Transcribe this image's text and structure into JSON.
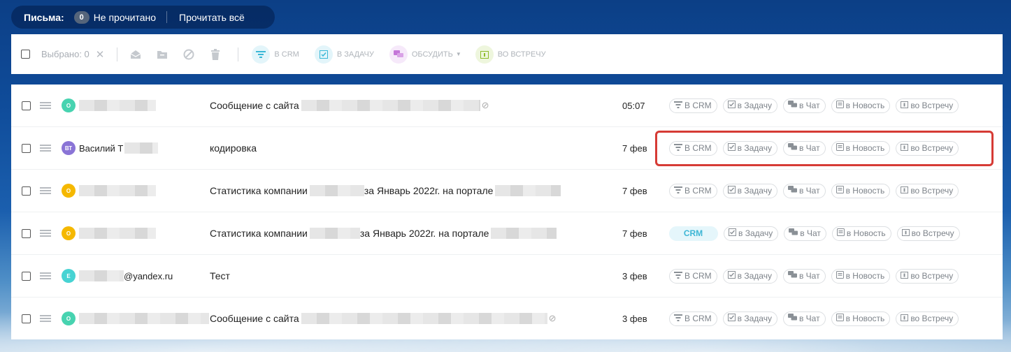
{
  "header": {
    "title": "Письма:",
    "unread_count": "0",
    "unread_label": "Не прочитано",
    "read_all": "Прочитать всё"
  },
  "toolbar": {
    "selected_label": "Выбрано: 0",
    "actions": [
      {
        "label": "в CRM",
        "color": "#39b7d6"
      },
      {
        "label": "в задачу",
        "color": "#39b7d6"
      },
      {
        "label": "обсудить",
        "color": "#c476d8"
      },
      {
        "label": "во встречу",
        "color": "#8dbb2a"
      }
    ]
  },
  "row_actions": {
    "crm": "В CRM",
    "task": "в Задачу",
    "chat": "в Чат",
    "news": "в Новость",
    "meet": "во Встречу",
    "crm_active": "CRM"
  },
  "rows": [
    {
      "avatar": "О",
      "avatar_color": "#47d3b0",
      "sender": "",
      "subject": "Сообщение с сайта",
      "date": "05:07"
    },
    {
      "avatar": "ВТ",
      "avatar_color": "#8a74d6",
      "sender": "Василий Т",
      "subject": "кодировка",
      "date": "7 фев"
    },
    {
      "avatar": "О",
      "avatar_color": "#f5b800",
      "sender": "",
      "subject": "Статистика компании",
      "subject_suffix": "за Январь 2022г. на портале",
      "date": "7 фев"
    },
    {
      "avatar": "О",
      "avatar_color": "#f5b800",
      "sender": "",
      "subject": "Статистика компании",
      "subject_suffix": "за Январь 2022г. на портале",
      "date": "7 фев"
    },
    {
      "avatar": "Е",
      "avatar_color": "#47d3d3",
      "sender": "@yandex.ru",
      "subject": "Тест",
      "date": "3 фев"
    },
    {
      "avatar": "О",
      "avatar_color": "#47d3b0",
      "sender": "",
      "subject": "Сообщение с сайта",
      "date": "3 фев"
    }
  ]
}
